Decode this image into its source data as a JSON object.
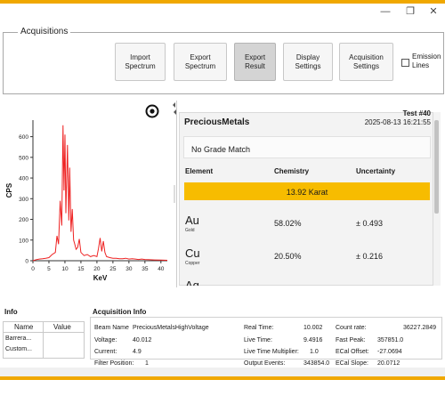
{
  "window": {
    "minimize_glyph": "—",
    "maximize_glyph": "❐",
    "close_glyph": "✕"
  },
  "acquisitions": {
    "title": "Acquisitions",
    "buttons": [
      {
        "label": "Import\nSpectrum"
      },
      {
        "label": "Export\nSpectrum"
      },
      {
        "label": "Export\nResult"
      },
      {
        "label": "Display\nSettings"
      },
      {
        "label": "Acquisition\nSettings"
      }
    ],
    "emission_lines": {
      "label": "Emission\nLines",
      "checked": false
    }
  },
  "chart_data": {
    "type": "line",
    "xlabel": "KeV",
    "ylabel": "CPS",
    "xlim": [
      0,
      42
    ],
    "ylim": [
      0,
      680
    ],
    "xticks": [
      0,
      5,
      10,
      15,
      20,
      25,
      30,
      35,
      40
    ],
    "yticks": [
      0,
      100,
      200,
      300,
      400,
      500,
      600
    ],
    "grid": false,
    "series": [
      {
        "x": [
          0,
          1,
          2,
          3,
          4,
          5,
          6,
          7,
          7.5,
          8,
          8.5,
          9,
          9.4,
          9.7,
          10,
          10.3,
          10.8,
          11.2,
          11.5,
          11.9,
          12.3,
          12.7,
          13,
          13.5,
          14,
          14.5,
          15,
          16,
          17,
          18,
          19,
          20,
          20.5,
          21,
          21.5,
          22,
          22.5,
          23,
          24,
          25,
          26,
          27,
          28,
          29,
          30,
          31,
          32,
          33,
          34,
          35,
          36,
          38,
          40,
          42
        ],
        "y": [
          0,
          5,
          8,
          10,
          12,
          15,
          30,
          40,
          120,
          80,
          290,
          170,
          655,
          340,
          610,
          230,
          560,
          195,
          450,
          140,
          250,
          100,
          85,
          55,
          65,
          105,
          40,
          25,
          30,
          20,
          25,
          20,
          60,
          110,
          45,
          95,
          40,
          20,
          15,
          12,
          12,
          10,
          10,
          12,
          8,
          10,
          8,
          6,
          8,
          6,
          5,
          4,
          3,
          2
        ]
      }
    ]
  },
  "results": {
    "library": "PreciousMetals",
    "test_number": "Test #40",
    "timestamp": "2025-08-13 16:21:55",
    "grade": "No Grade Match",
    "headers": {
      "element": "Element",
      "chemistry": "Chemistry",
      "uncertainty": "Uncertainty"
    },
    "karat": "13.92 Karat",
    "highlight_color": "#f7bc00",
    "elements": [
      {
        "symbol": "Au",
        "name": "Gold",
        "chemistry": "58.02%",
        "uncertainty": "± 0.493"
      },
      {
        "symbol": "Cu",
        "name": "Copper",
        "chemistry": "20.50%",
        "uncertainty": "± 0.216"
      },
      {
        "symbol": "Ag",
        "name": "",
        "chemistry": "",
        "uncertainty": ""
      }
    ]
  },
  "info": {
    "title": "Info",
    "headers": {
      "name": "Name",
      "value": "Value"
    },
    "rows": [
      {
        "name": "Barrera..."
      },
      {
        "name": "Custom..."
      }
    ]
  },
  "acq_info": {
    "title": "Acquisition Info",
    "beam_name_label": "Beam Name",
    "beam_name": "PreciousMetalsHighVoltage",
    "voltage_label": "Voltage:",
    "voltage": "40.012",
    "current_label": "Current:",
    "current": "4.9",
    "filter_label": "Filter Position:",
    "filter": "1",
    "real_time_label": "Real Time:",
    "real_time": "10.002",
    "live_time_label": "Live Time:",
    "live_time": "9.4916",
    "ltm_label": "Live Time Multiplier:",
    "ltm": "1.0",
    "output_events_label": "Output Events:",
    "output_events": "343854.0",
    "count_rate_label": "Count rate:",
    "count_rate": "36227.2849",
    "fast_peak_label": "Fast Peak:",
    "fast_peak": "357851.0",
    "ecal_offset_label": "ECal Offset:",
    "ecal_offset": "-27.0694",
    "ecal_slope_label": "ECal Slope:",
    "ecal_slope": "20.0712"
  },
  "theme": {
    "accent": "#f0a800",
    "spectrum_color": "#ee2222"
  }
}
